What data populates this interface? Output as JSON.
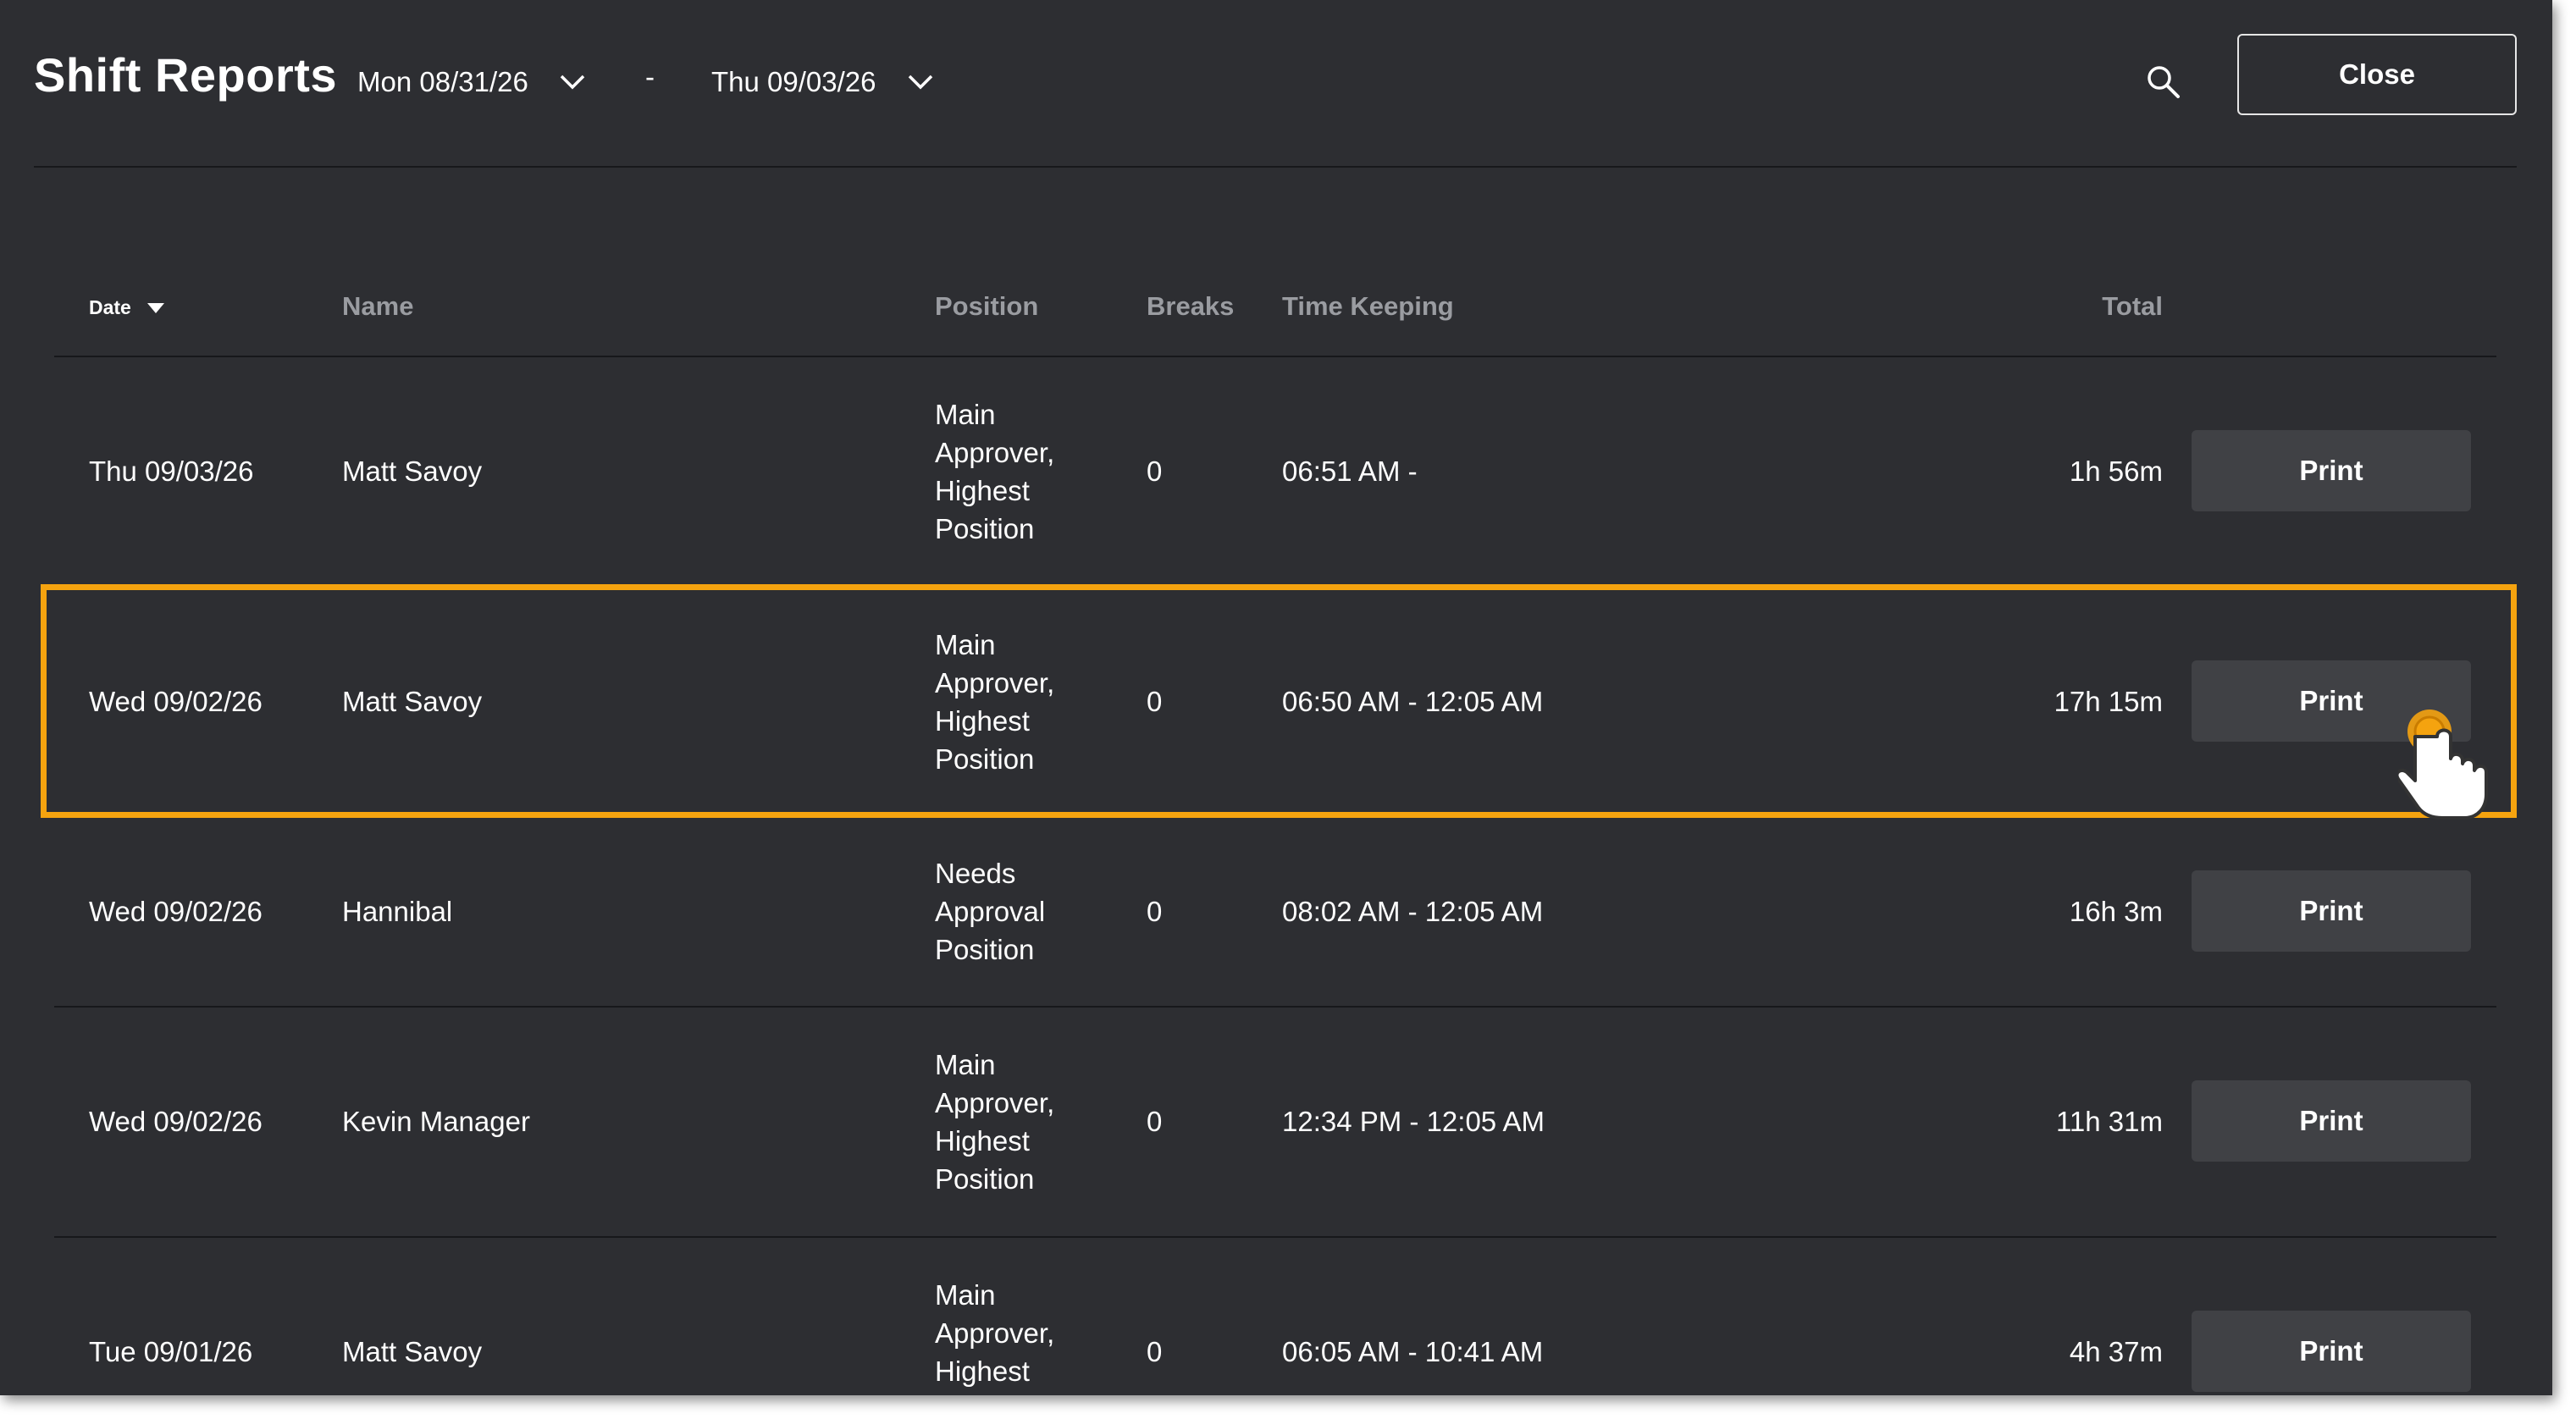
{
  "header": {
    "title": "Shift Reports",
    "start_date": "Mon 08/31/26",
    "separator": "-",
    "end_date": "Thu 09/03/26",
    "close_label": "Close"
  },
  "table": {
    "columns": {
      "date": "Date",
      "name": "Name",
      "position": "Position",
      "breaks": "Breaks",
      "time_keeping": "Time Keeping",
      "total": "Total"
    },
    "rows": [
      {
        "date": "Thu 09/03/26",
        "name": "Matt Savoy",
        "position": "Main\nApprover,\nHighest\nPosition",
        "breaks": "0",
        "time_keeping": "06:51 AM -",
        "total": "1h 56m",
        "action": "Print"
      },
      {
        "date": "Wed 09/02/26",
        "name": "Matt Savoy",
        "position": "Main\nApprover,\nHighest\nPosition",
        "breaks": "0",
        "time_keeping": "06:50 AM - 12:05 AM",
        "total": "17h 15m",
        "action": "Print"
      },
      {
        "date": "Wed 09/02/26",
        "name": "Hannibal",
        "position": "Needs\nApproval\nPosition",
        "breaks": "0",
        "time_keeping": "08:02 AM - 12:05 AM",
        "total": "16h 3m",
        "action": "Print"
      },
      {
        "date": "Wed 09/02/26",
        "name": "Kevin Manager",
        "position": "Main\nApprover,\nHighest\nPosition",
        "breaks": "0",
        "time_keeping": "12:34 PM - 12:05 AM",
        "total": "11h 31m",
        "action": "Print"
      },
      {
        "date": "Tue 09/01/26",
        "name": "Matt Savoy",
        "position": "Main\nApprover,\nHighest\nPosition",
        "breaks": "0",
        "time_keeping": "06:05 AM - 10:41 AM",
        "total": "4h 37m",
        "action": "Print"
      }
    ]
  },
  "colors": {
    "background": "#2d2e32",
    "button": "#404145",
    "highlight": "#f5a30f",
    "header_text": "#9a9ca1"
  },
  "icons": {
    "search": "search-icon",
    "dropdown": "chevron-down-icon",
    "sort": "sort-desc-icon",
    "cursor": "pointer-hand-icon"
  }
}
